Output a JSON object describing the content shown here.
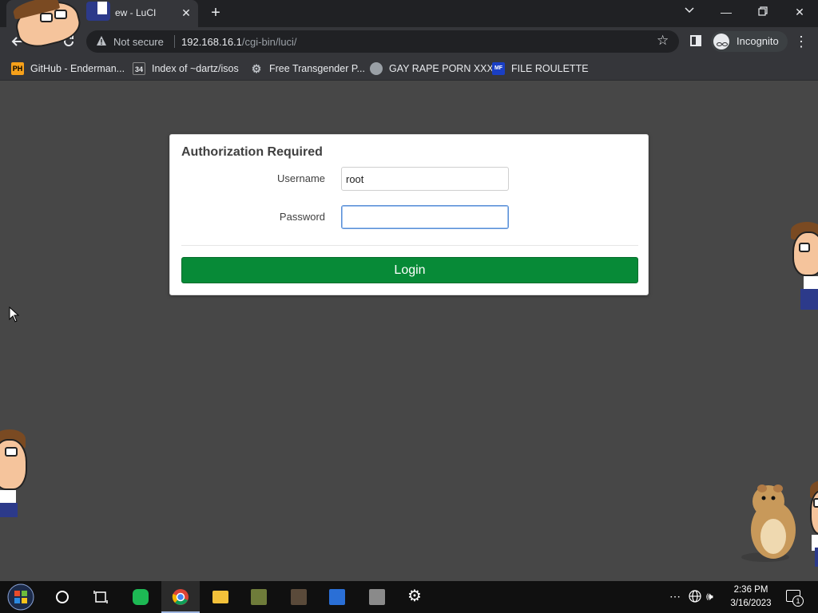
{
  "browser": {
    "tab": {
      "title": "ew - LuCI"
    },
    "omnibox": {
      "security_label": "Not secure",
      "url_host": "192.168.16.1",
      "url_path": "/cgi-bin/luci/"
    },
    "incognito_label": "Incognito",
    "bookmarks": [
      {
        "label": "GitHub - Enderman...",
        "icon": "ph-icon",
        "icon_text": "PH",
        "color": "#f7a11a"
      },
      {
        "label": "Index of ~dartz/isos",
        "icon": "index-icon",
        "icon_text": "34",
        "color": "#35363a"
      },
      {
        "label": "Free Transgender P...",
        "icon": "gear-favicon-icon",
        "icon_text": "",
        "color": "#bdc1c6"
      },
      {
        "label": "GAY RAPE PORN XXX",
        "icon": "globe-icon",
        "icon_text": "",
        "color": "#9aa0a6"
      },
      {
        "label": "FILE ROULETTE",
        "icon": "file-roulette-icon",
        "icon_text": "MF",
        "color": "#1a3fc4"
      }
    ]
  },
  "login": {
    "title": "Authorization Required",
    "username_label": "Username",
    "username_value": "root",
    "password_label": "Password",
    "password_value": "",
    "submit_label": "Login",
    "accent_color": "#078a37"
  },
  "taskbar": {
    "time": "2:36 PM",
    "date": "3/16/2023",
    "notification_count": "1",
    "apps": [
      {
        "name": "start-button",
        "icon": "windows-logo-icon"
      },
      {
        "name": "search-button",
        "icon": "search-circle-icon"
      },
      {
        "name": "task-view-button",
        "icon": "task-view-icon"
      },
      {
        "name": "taskbar-app-chat",
        "icon": "chat-icon",
        "color": "#1db954"
      },
      {
        "name": "taskbar-app-chrome",
        "icon": "chrome-icon",
        "active": true
      },
      {
        "name": "taskbar-app-explorer",
        "icon": "folder-icon",
        "color": "#f3c13a"
      },
      {
        "name": "taskbar-app-game1",
        "icon": "game-icon"
      },
      {
        "name": "taskbar-app-game2",
        "icon": "game-icon"
      },
      {
        "name": "taskbar-app-3",
        "icon": "app-icon"
      },
      {
        "name": "taskbar-app-4",
        "icon": "app-icon"
      },
      {
        "name": "taskbar-settings",
        "icon": "gear-icon"
      }
    ]
  }
}
